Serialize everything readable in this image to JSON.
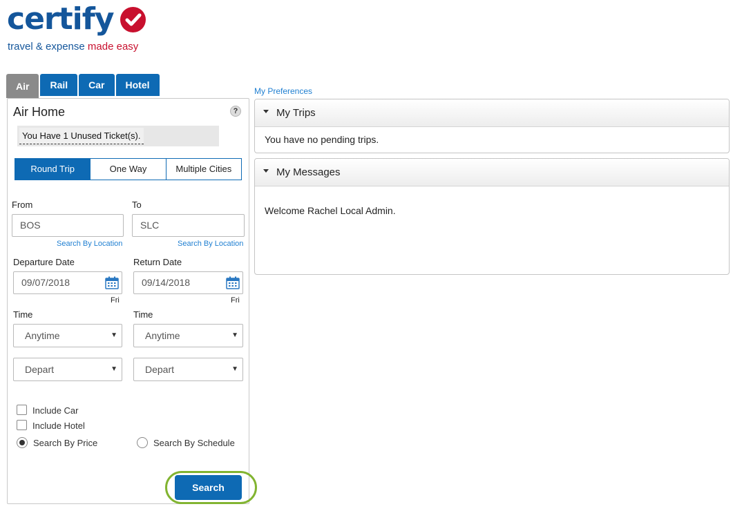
{
  "brand": {
    "name": "certify",
    "tagline_main": "travel & expense",
    "tagline_accent": "made easy",
    "blue": "#14569b",
    "red": "#c8102e"
  },
  "tabs": [
    {
      "label": "Air",
      "active": true
    },
    {
      "label": "Rail",
      "active": false
    },
    {
      "label": "Car",
      "active": false
    },
    {
      "label": "Hotel",
      "active": false
    }
  ],
  "air_panel": {
    "title": "Air Home",
    "help_glyph": "?",
    "unused_tickets": "You Have 1 Unused Ticket(s).",
    "trip_types": [
      {
        "label": "Round Trip",
        "active": true
      },
      {
        "label": "One Way",
        "active": false
      },
      {
        "label": "Multiple Cities",
        "active": false
      }
    ],
    "from": {
      "label": "From",
      "value": "BOS",
      "link": "Search By Location"
    },
    "to": {
      "label": "To",
      "value": "SLC",
      "link": "Search By Location"
    },
    "departure": {
      "label": "Departure Date",
      "value": "09/07/2018",
      "day": "Fri"
    },
    "return": {
      "label": "Return Date",
      "value": "09/14/2018",
      "day": "Fri"
    },
    "time_left": {
      "label": "Time",
      "time": "Anytime",
      "mode": "Depart"
    },
    "time_right": {
      "label": "Time",
      "time": "Anytime",
      "mode": "Depart"
    },
    "include_car": {
      "label": "Include Car",
      "checked": false
    },
    "include_hotel": {
      "label": "Include Hotel",
      "checked": false
    },
    "search_by_price": {
      "label": "Search By Price",
      "selected": true
    },
    "search_by_schedule": {
      "label": "Search By Schedule",
      "selected": false
    },
    "search_button": "Search"
  },
  "preferences_link": "My Preferences",
  "my_trips": {
    "title": "My Trips",
    "body": "You have no pending trips."
  },
  "my_messages": {
    "title": "My Messages",
    "body": "Welcome Rachel Local Admin."
  },
  "colors": {
    "primary": "#0e6ab4",
    "highlight_ring": "#82b431",
    "link": "#1f7fd1"
  }
}
